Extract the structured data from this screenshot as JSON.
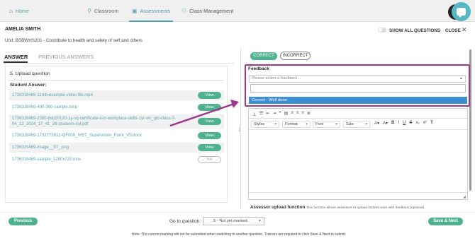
{
  "nav": {
    "home": "Home",
    "classroom": "Classroom",
    "assessments": "Assessments",
    "class_management": "Class Management"
  },
  "header": {
    "student_name": "AMELIA SMITH",
    "unit": "Unit: BSBWHS201 - Contribute to health and safety of self and others",
    "show_all": "SHOW ALL QUESTIONS",
    "close": "CLOSE"
  },
  "tabs": {
    "answer": "ANSWER",
    "previous": "PREVIOUS ANSWERS"
  },
  "question": {
    "title": "5. Upload question",
    "student_answer_label": "Student Answer:",
    "files": [
      {
        "name": "1736319469-11mb-example-video-file.mp4",
        "action": "View"
      },
      {
        "name": "1736319469-400-360-sample.bmp",
        "action": "View"
      },
      {
        "name": "1736319469-2280-bsb20120-1y-vq-certificate-ii-in-workplace-skills-1yr-vic_qld-class-3-04_12_2024_17_41_26-students-list.pdf",
        "action": "View"
      },
      {
        "name": "1736319469-1732773621-QF008_IVET_Supervision_Form_V5.docx",
        "action": "View"
      },
      {
        "name": "1736319469-image__97_.png",
        "action": "View"
      },
      {
        "name": "1736319469-sample_1280x720.mov",
        "action": "NA"
      }
    ]
  },
  "marking": {
    "correct": "CORRECT",
    "incorrect": "INCORRECT",
    "feedback_label": "Feedback",
    "feedback_placeholder": "Please select a feedback...",
    "feedback_option": "Correct - Well done"
  },
  "editor": {
    "styles": "Styles",
    "format": "Format",
    "font": "Font",
    "size": "Size"
  },
  "upload_function": {
    "title": "Assessor upload function",
    "desc": "This function allows assessors to upload student work with feedback (optional)."
  },
  "footer": {
    "previous": "Previous",
    "goto_label": "Go to question:",
    "goto_value": "5 - Not yet marked",
    "save_next": "Save & Next",
    "note": "Note: The current marking will not be submitted when switching to another question. Trainers are required to click Save & Next to submit."
  },
  "colors": {
    "accent_green": "#4db28d",
    "highlight_purple": "#a1368e",
    "link_teal": "#58a6ae",
    "option_blue": "#3d8fd1"
  }
}
